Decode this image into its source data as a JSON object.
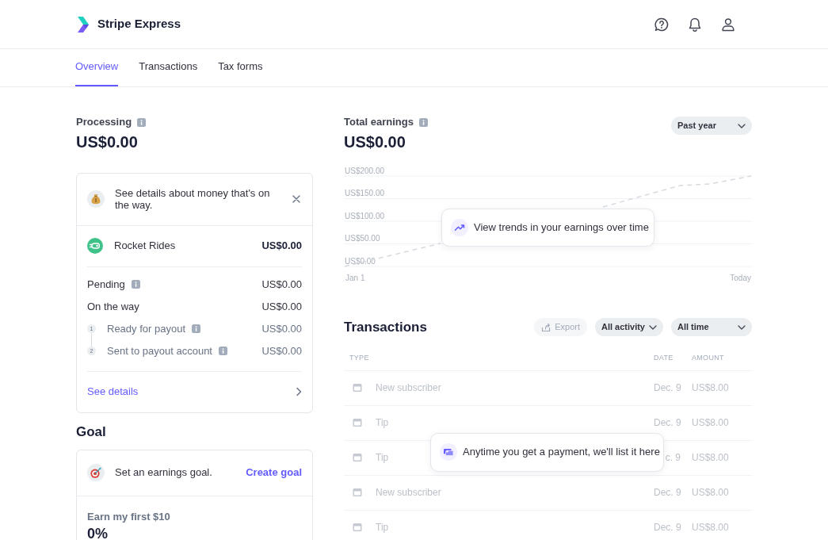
{
  "header": {
    "brand": "Stripe Express"
  },
  "tabs": [
    {
      "label": "Overview",
      "selected": true
    },
    {
      "label": "Transactions",
      "selected": false
    },
    {
      "label": "Tax forms",
      "selected": false
    }
  ],
  "processing": {
    "label": "Processing",
    "amount": "US$0.00",
    "notice": "See details about money that's on the way.",
    "account": {
      "name": "Rocket Rides",
      "amount": "US$0.00"
    },
    "lines": [
      {
        "kind": "total",
        "label": "Pending",
        "info": true,
        "amount": "US$0.00"
      },
      {
        "kind": "total",
        "label": "On the way",
        "info": false,
        "amount": "US$0.00"
      },
      {
        "kind": "step",
        "number": "1",
        "label": "Ready for payout",
        "info": true,
        "amount": "US$0.00"
      },
      {
        "kind": "step",
        "number": "2",
        "label": "Sent to payout account",
        "info": true,
        "amount": "US$0.00"
      }
    ],
    "link": "See details"
  },
  "goal": {
    "title": "Goal",
    "prompt": "Set an earnings goal.",
    "action": "Create goal",
    "target": "Earn my first $10",
    "percent": "0%"
  },
  "earnings": {
    "label": "Total earnings",
    "amount": "US$0.00",
    "period": "Past year",
    "placeholder_chart": {
      "y_labels": [
        "US$200.00",
        "US$150.00",
        "US$100.00",
        "US$50.00",
        "US$0.00"
      ],
      "x_labels": [
        "Jan 1",
        "Today"
      ]
    },
    "hint": "View trends in your earnings over time"
  },
  "transactions": {
    "title": "Transactions",
    "buttons": [
      {
        "kind": "export",
        "label": "Export",
        "disabled": true
      },
      {
        "kind": "filter",
        "label": "All activity",
        "disabled": false
      },
      {
        "kind": "select",
        "label": "All time",
        "disabled": false
      }
    ],
    "columns": [
      "TYPE",
      "DATE",
      "AMOUNT"
    ],
    "rows": [
      {
        "type": "New subscriber",
        "date": "Dec. 9",
        "amount": "US$8.00"
      },
      {
        "type": "Tip",
        "date": "Dec. 9",
        "amount": "US$8.00"
      },
      {
        "type": "Tip",
        "date": "c. 9",
        "amount": "US$8.00"
      },
      {
        "type": "New subscriber",
        "date": "Dec. 9",
        "amount": "US$8.00"
      },
      {
        "type": "Tip",
        "date": "Dec. 9",
        "amount": "US$8.00"
      }
    ],
    "hint": "Anytime you get a payment, we'll list it here"
  }
}
